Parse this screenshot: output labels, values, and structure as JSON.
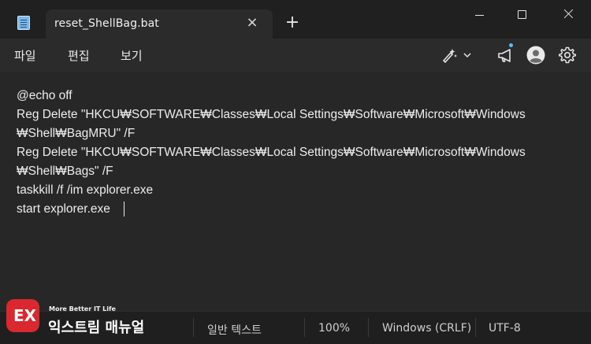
{
  "window": {
    "tab_title": "reset_ShellBag.bat",
    "close_tab_glyph": "×",
    "new_tab_glyph": "+"
  },
  "menubar": {
    "file": "파일",
    "edit": "편집",
    "view": "보기"
  },
  "toolbar": {
    "copilot_icon": "copilot-icon",
    "chevron_icon": "chevron-down-icon",
    "announcement_icon": "megaphone-icon",
    "profile_icon": "profile-icon",
    "settings_icon": "gear-icon"
  },
  "editor": {
    "lines": [
      "@echo off",
      "Reg Delete \"HKCU₩SOFTWARE₩Classes₩Local Settings₩Software₩Microsoft₩Windows",
      "₩Shell₩BagMRU\" /F",
      "Reg Delete \"HKCU₩SOFTWARE₩Classes₩Local Settings₩Software₩Microsoft₩Windows",
      "₩Shell₩Bags\" /F",
      "taskkill /f /im explorer.exe",
      "start explorer.exe"
    ]
  },
  "statusbar": {
    "text_mode": "일반 텍스트",
    "zoom": "100%",
    "line_ending": "Windows (CRLF)",
    "encoding": "UTF-8"
  },
  "watermark": {
    "logo_text": "EX",
    "tagline": "More Better IT Life",
    "brand": "익스트림 매뉴얼"
  },
  "colors": {
    "accent": "#4cc2ff",
    "logo_red": "#d9282f"
  }
}
